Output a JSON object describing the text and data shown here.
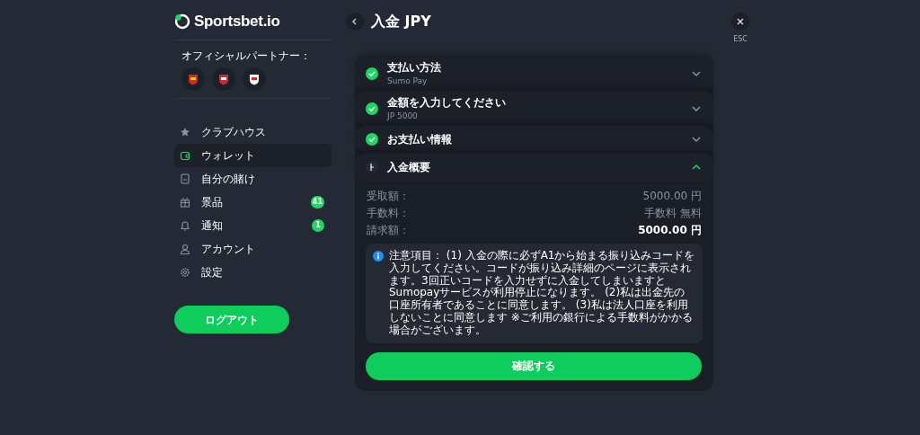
{
  "brand": {
    "name": "Sportsbet.io"
  },
  "partners": {
    "label": "オフィシャルパートナー："
  },
  "nav": [
    {
      "label": "クラブハウス",
      "selected": false
    },
    {
      "label": "ウォレット",
      "selected": true
    },
    {
      "label": "自分の賭け",
      "selected": false
    },
    {
      "label": "景品",
      "selected": false,
      "badge": "41"
    },
    {
      "label": "通知",
      "selected": false,
      "badge": "1"
    },
    {
      "label": "アカウント",
      "selected": false
    },
    {
      "label": "設定",
      "selected": false
    }
  ],
  "logout_button": "ログアウト",
  "header": {
    "title": "入金 JPY",
    "close_hint": "ESC"
  },
  "steps": [
    {
      "title": "支払い方法",
      "subtitle": "Sumo Pay",
      "completed": true,
      "expanded": false
    },
    {
      "title": "金額を入力してください",
      "subtitle": "JP 5000",
      "completed": true,
      "expanded": false
    },
    {
      "title": "お支払い情報",
      "completed": true,
      "expanded": false
    },
    {
      "title": "入金概要",
      "completed": false,
      "expanded": true
    }
  ],
  "summary": [
    {
      "label": "受取額：",
      "value": "5000.00 円",
      "kind": "normal"
    },
    {
      "label": "手数料：",
      "value": "手数料 無料",
      "kind": "normal"
    },
    {
      "label": "請求額：",
      "value": "5000.00 円",
      "kind": "total"
    }
  ],
  "notice": "注意項目： (1) 入金の際に必ずA1から始まる振り込みコードを入力してください。コードが振り込み詳細のページに表示されます。3回正いコードを入力せずに入金してしまいますとSumopayサービスが利用停止になります。 (2)私は出金先の口座所有者であることに同意します。 (3)私は法人口座を利用しないことに同意します ※ご利用の銀行による手数料がかかる場合がございます。",
  "confirm_button": "確認する"
}
